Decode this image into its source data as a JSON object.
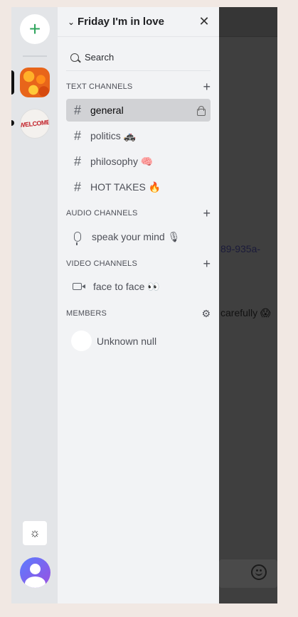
{
  "guild": {
    "name": "Friday I'm in love"
  },
  "search": {
    "label": "Search"
  },
  "sections": {
    "text": "TEXT CHANNELS",
    "audio": "AUDIO CHANNELS",
    "video": "VIDEO CHANNELS",
    "members": "MEMBERS"
  },
  "text_channels": [
    {
      "name": "general",
      "active": true,
      "locked": true
    },
    {
      "name": "politics 🚓"
    },
    {
      "name": "philosophy 🧠"
    },
    {
      "name": "HOT TAKES 🔥"
    }
  ],
  "audio_channels": [
    {
      "name": "speak your mind 🎙"
    }
  ],
  "video_channels": [
    {
      "name": "face to face 👀"
    }
  ],
  "members": [
    {
      "name": "Unknown null"
    }
  ],
  "servers": [
    {
      "name": "flowers"
    },
    {
      "label": "WELCOME"
    }
  ],
  "background_chat": {
    "fragment_1": "89-935a-",
    "fragment_2": "carefully 😱"
  },
  "colors": {
    "accent_add": "#2ea45c",
    "panel_bg": "#f2f3f5",
    "rail_bg": "#e3e5e8",
    "active_channel_bg": "#d1d2d5",
    "overlay": "#3f3f3f"
  },
  "icons": {
    "add_server": "plus-icon",
    "theme": "sun-icon",
    "search": "search-icon",
    "close": "close-icon",
    "collapse": "chevron-down-icon",
    "lock": "lock-icon",
    "text_channel": "hash-icon",
    "audio_channel": "microphone-icon",
    "video_channel": "video-camera-icon",
    "members_settings": "gear-icon",
    "emoji": "emoji-icon"
  }
}
